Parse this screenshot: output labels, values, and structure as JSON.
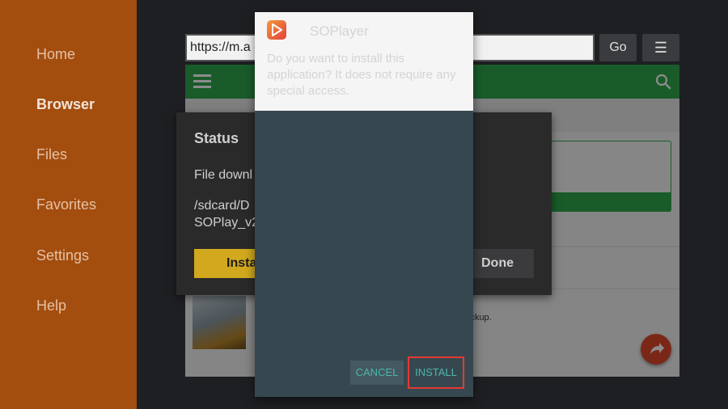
{
  "sidebar": {
    "items": [
      {
        "label": "Home"
      },
      {
        "label": "Browser"
      },
      {
        "label": "Files"
      },
      {
        "label": "Favorites"
      },
      {
        "label": "Settings"
      },
      {
        "label": "Help"
      }
    ],
    "active": "Browser"
  },
  "browser": {
    "url": "https://m.a                                        oid/download/158-A",
    "go_label": "Go",
    "menu_icon": "☰"
  },
  "webpage": {
    "snippet": "ickup."
  },
  "status_dialog": {
    "title": "Status",
    "line1": "File downl",
    "path_line1": "/sdcard/D",
    "path_line2": "SOPlay_v2",
    "install_label": "Insta",
    "done_label": "Done"
  },
  "install_dialog": {
    "app_name": "SOPlayer",
    "question": "Do you want to install this application? It does not require any special access.",
    "cancel_label": "CANCEL",
    "install_label": "INSTALL"
  },
  "colors": {
    "sidebar_bg": "#a34d0f",
    "web_header": "#2ea84e",
    "dialog_bg": "#37474f",
    "accent_teal": "#4db6ac",
    "highlight_red": "#e53935",
    "status_install": "#d2a91e"
  }
}
